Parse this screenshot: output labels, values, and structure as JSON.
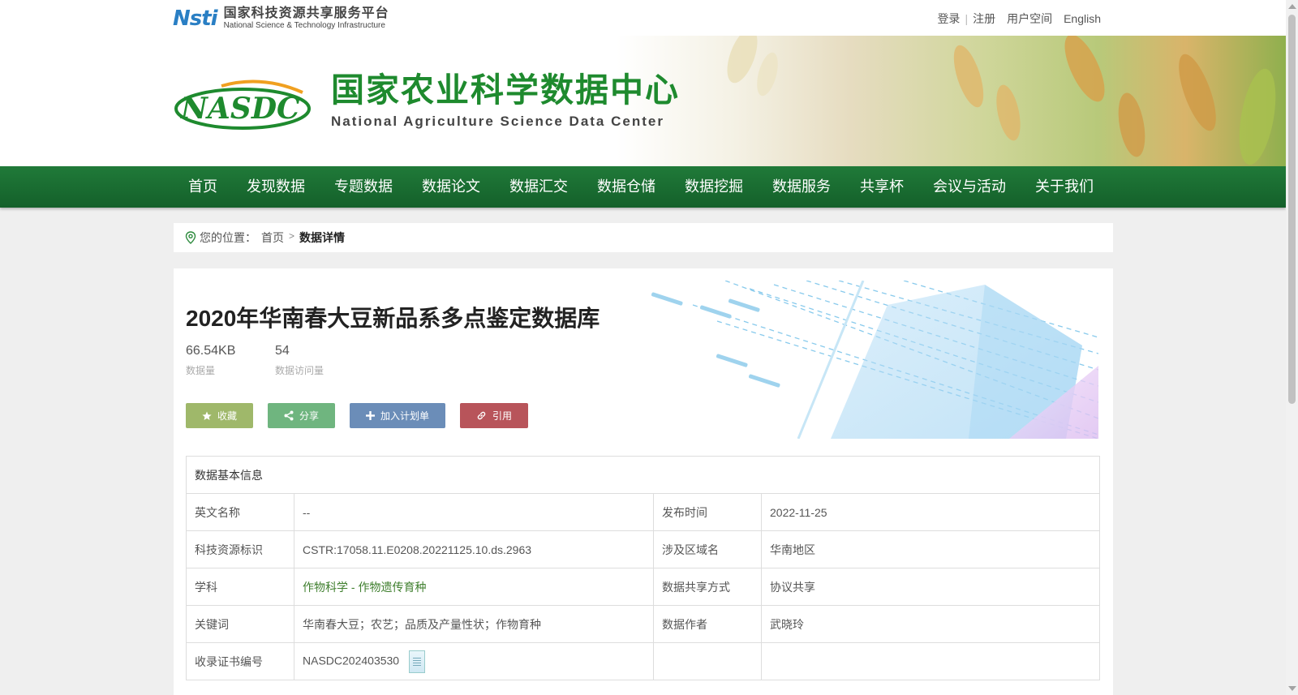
{
  "platform": {
    "logo_mark": "Nsti",
    "name_cn": "国家科技资源共享服务平台",
    "name_en": "National Science & Technology Infrastructure"
  },
  "toplinks": {
    "login": "登录",
    "register": "注册",
    "user_space": "用户空间",
    "english": "English"
  },
  "center": {
    "logo_text": "NASDC",
    "name_cn": "国家农业科学数据中心",
    "name_en": "National Agriculture Science Data Center"
  },
  "nav": [
    "首页",
    "发现数据",
    "专题数据",
    "数据论文",
    "数据汇交",
    "数据仓储",
    "数据挖掘",
    "数据服务",
    "共享杯",
    "会议与活动",
    "关于我们"
  ],
  "breadcrumb": {
    "prefix": "您的位置：",
    "home": "首页",
    "current": "数据详情"
  },
  "dataset": {
    "title": "2020年华南春大豆新品系多点鉴定数据库",
    "size_value": "66.54KB",
    "size_label": "数据量",
    "visits_value": "54",
    "visits_label": "数据访问量"
  },
  "actions": {
    "favorite": "收藏",
    "share": "分享",
    "add_plan": "加入计划单",
    "cite": "引用"
  },
  "info": {
    "heading": "数据基本信息",
    "rows": [
      {
        "k1": "英文名称",
        "v1": "--",
        "k2": "发布时间",
        "v2": "2022-11-25"
      },
      {
        "k1": "科技资源标识",
        "v1": "CSTR:17058.11.E0208.20221125.10.ds.2963",
        "k2": "涉及区域名",
        "v2": "华南地区"
      },
      {
        "k1": "学科",
        "v1": "作物科学 - 作物遗传育种",
        "k2": "数据共享方式",
        "v2": "协议共享"
      },
      {
        "k1": "关键词",
        "v1": "华南春大豆；农艺；品质及产量性状；作物育种",
        "k2": "数据作者",
        "v2": "武晓玲"
      },
      {
        "k1": "收录证书编号",
        "v1": "NASDC202403530",
        "k2": "",
        "v2": ""
      }
    ]
  },
  "colors": {
    "nav_green": "#1a6e32",
    "title_green": "#1e8a2e",
    "btn_favorite": "#9fb86a",
    "btn_share": "#6fb57f",
    "btn_plan": "#6b8db8",
    "btn_cite": "#b8545a"
  }
}
